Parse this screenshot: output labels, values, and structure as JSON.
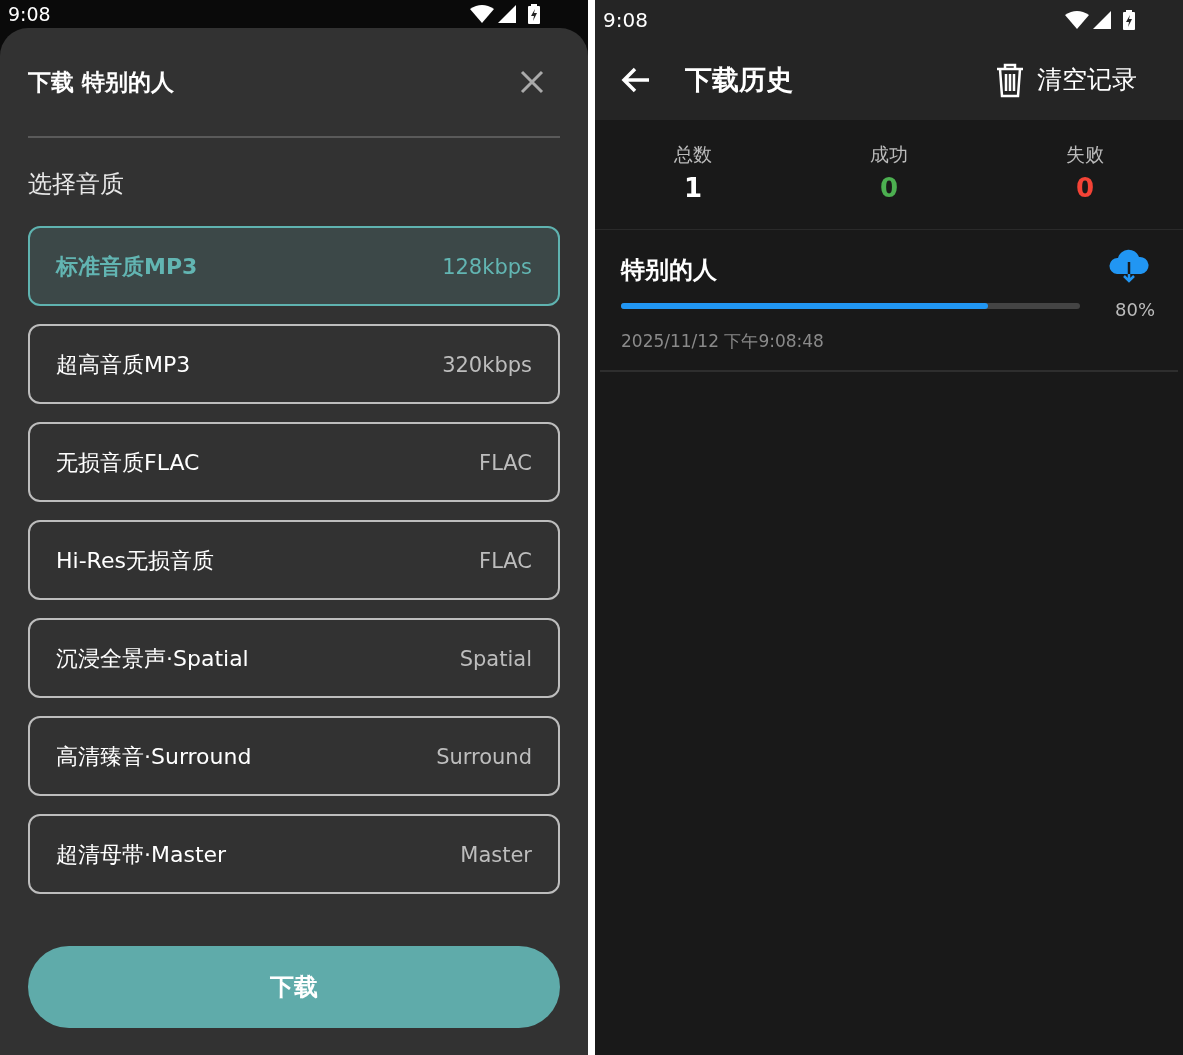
{
  "left_screen": {
    "status_bar": {
      "time": "9:08"
    },
    "sheet": {
      "title": "下载 特别的人",
      "section_label": "选择音质",
      "options": [
        {
          "name": "标准音质MP3",
          "detail": "128kbps",
          "selected": true
        },
        {
          "name": "超高音质MP3",
          "detail": "320kbps",
          "selected": false
        },
        {
          "name": "无损音质FLAC",
          "detail": "FLAC",
          "selected": false
        },
        {
          "name": "Hi-Res无损音质",
          "detail": "FLAC",
          "selected": false
        },
        {
          "name": "沉浸全景声·Spatial",
          "detail": "Spatial",
          "selected": false
        },
        {
          "name": "高清臻音·Surround",
          "detail": "Surround",
          "selected": false
        },
        {
          "name": "超清母带·Master",
          "detail": "Master",
          "selected": false
        }
      ],
      "download_button": "下载"
    }
  },
  "right_screen": {
    "status_bar": {
      "time": "9:08"
    },
    "header": {
      "title": "下载历史",
      "clear_button": "清空记录"
    },
    "stats": [
      {
        "label": "总数",
        "value": "1",
        "color": "#ffffff"
      },
      {
        "label": "成功",
        "value": "0",
        "color": "#4caf50"
      },
      {
        "label": "失败",
        "value": "0",
        "color": "#f44336"
      }
    ],
    "downloads": [
      {
        "title": "特别的人",
        "level": 0.8,
        "percent": "80%",
        "time": "2025/11/12 下午9:08:48"
      }
    ]
  }
}
